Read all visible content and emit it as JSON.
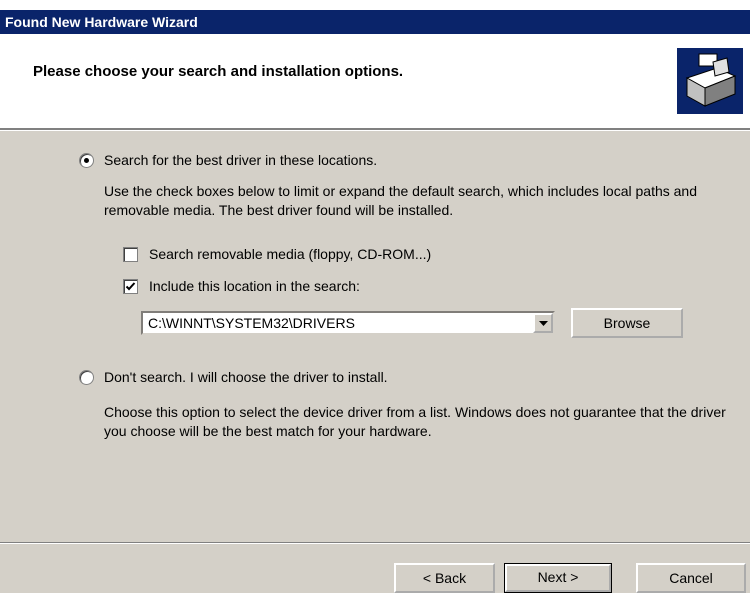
{
  "window": {
    "title": "Found New Hardware Wizard"
  },
  "header": {
    "heading": "Please choose your search and installation options."
  },
  "option_search": {
    "label": "Search for the best driver in these locations.",
    "selected": true,
    "description": "Use the check boxes below to limit or expand the default search, which includes local paths and removable media. The best driver found will be installed.",
    "removable_media": {
      "label": "Search removable media (floppy, CD-ROM...)",
      "checked": false
    },
    "include_location": {
      "label": "Include this location in the search:",
      "checked": true
    },
    "location_value": "C:\\WINNT\\SYSTEM32\\DRIVERS",
    "browse_label": "Browse"
  },
  "option_manual": {
    "label": "Don't search. I will choose the driver to install.",
    "selected": false,
    "description": "Choose this option to select the device driver from a list.  Windows does not guarantee that the driver you choose will be the best match for your hardware."
  },
  "footer": {
    "back_label": "< Back",
    "next_label": "Next >",
    "cancel_label": "Cancel"
  }
}
